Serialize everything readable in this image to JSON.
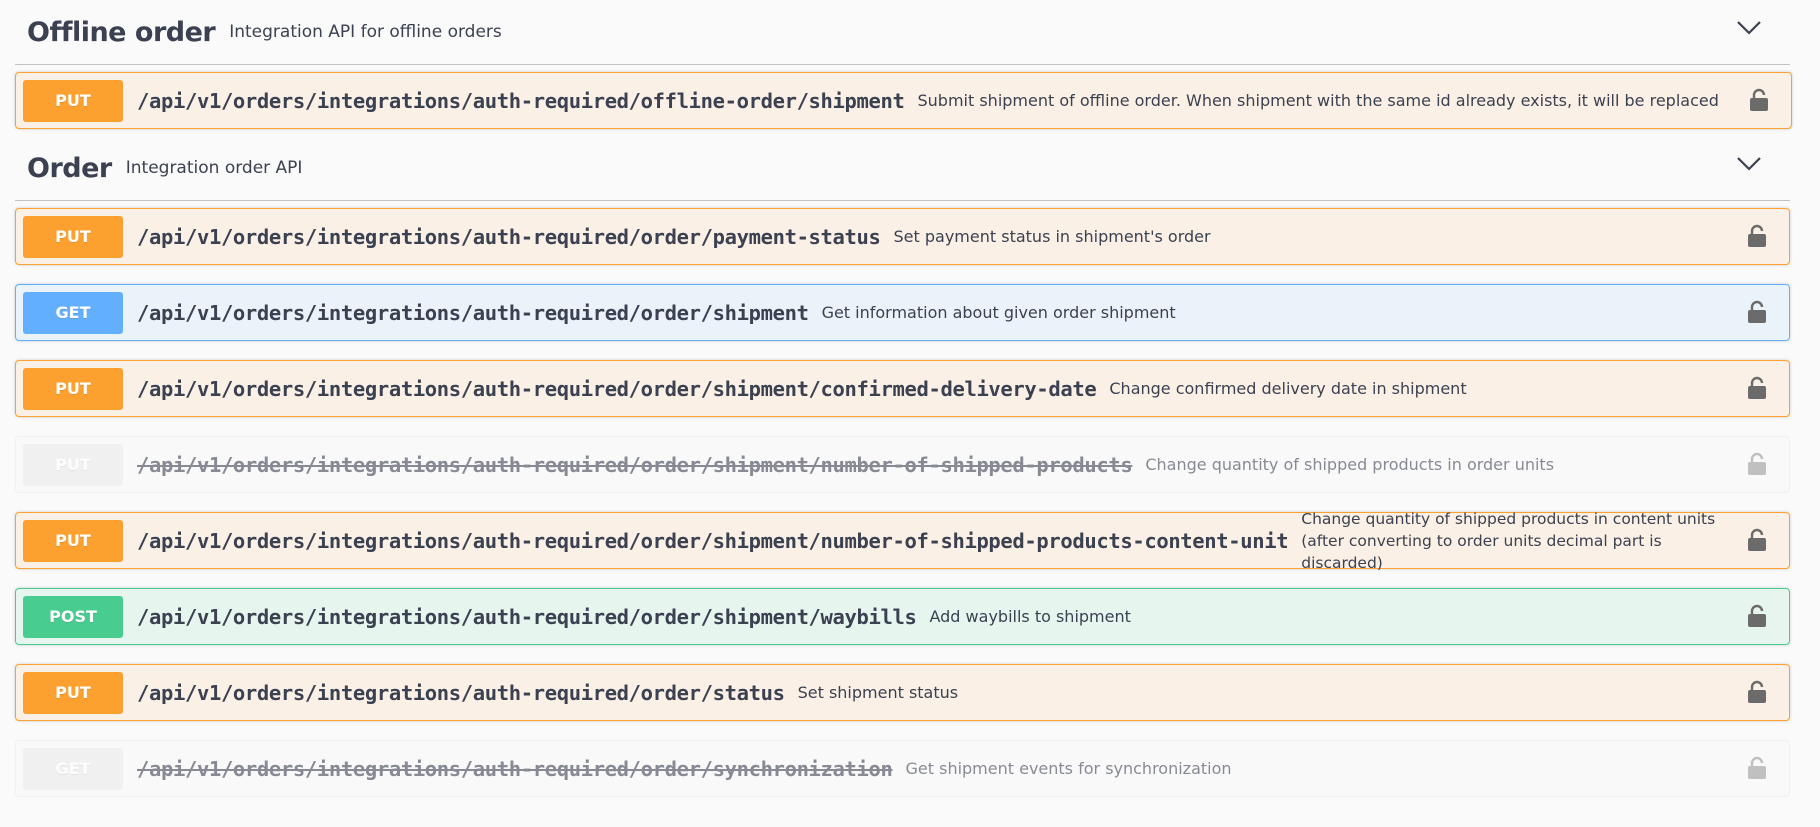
{
  "groups": [
    {
      "name": "Offline order",
      "description": "Integration API for offline orders",
      "chevron_icon": "chevron-down-icon",
      "operations": [
        {
          "method": "PUT",
          "path": "/api/v1/orders/integrations/auth-required/offline-order/shipment",
          "summary": "Submit shipment of offline order. When shipment with the same id already exists, it will be replaced",
          "deprecated": false,
          "lock_icon": "lock-icon"
        }
      ]
    },
    {
      "name": "Order",
      "description": "Integration order API",
      "chevron_icon": "chevron-down-icon",
      "operations": [
        {
          "method": "PUT",
          "path": "/api/v1/orders/integrations/auth-required/order/payment-status",
          "summary": "Set payment status in shipment's order",
          "deprecated": false,
          "lock_icon": "lock-icon"
        },
        {
          "method": "GET",
          "path": "/api/v1/orders/integrations/auth-required/order/shipment",
          "summary": "Get information about given order shipment",
          "deprecated": false,
          "lock_icon": "lock-icon"
        },
        {
          "method": "PUT",
          "path": "/api/v1/orders/integrations/auth-required/order/shipment/confirmed-delivery-date",
          "summary": "Change confirmed delivery date in shipment",
          "deprecated": false,
          "lock_icon": "lock-icon"
        },
        {
          "method": "PUT",
          "path": "/api/v1/orders/integrations/auth-required/order/shipment/number-of-shipped-products",
          "summary": "Change quantity of shipped products in order units",
          "deprecated": true,
          "lock_icon": "lock-icon"
        },
        {
          "method": "PUT",
          "path": "/api/v1/orders/integrations/auth-required/order/shipment/number-of-shipped-products-content-unit",
          "summary": "Change quantity of shipped products in content units (after converting to order units decimal part is discarded)",
          "deprecated": false,
          "lock_icon": "lock-icon"
        },
        {
          "method": "POST",
          "path": "/api/v1/orders/integrations/auth-required/order/shipment/waybills",
          "summary": "Add waybills to shipment",
          "deprecated": false,
          "lock_icon": "lock-icon"
        },
        {
          "method": "PUT",
          "path": "/api/v1/orders/integrations/auth-required/order/status",
          "summary": "Set shipment status",
          "deprecated": false,
          "lock_icon": "lock-icon"
        },
        {
          "method": "GET",
          "path": "/api/v1/orders/integrations/auth-required/order/synchronization",
          "summary": "Get shipment events for synchronization",
          "deprecated": true,
          "lock_icon": "lock-icon"
        }
      ]
    }
  ],
  "colors": {
    "put": "#fca130",
    "get": "#61affe",
    "post": "#49cc90",
    "deprecated": "#ebebeb",
    "text": "#3b4151",
    "lock": "#6b6b6b"
  }
}
